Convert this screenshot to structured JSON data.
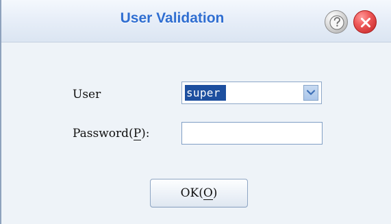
{
  "dialog": {
    "title": "User Validation",
    "colors": {
      "title_text": "#2f6ed1",
      "help_button": "#b5b5b5",
      "close_button": "#d73b3b"
    },
    "icons": {
      "help": "question-icon",
      "close": "close-icon",
      "dropdown": "chevron-down-icon"
    }
  },
  "form": {
    "user_label": "User",
    "user_value": "super",
    "password_label_prefix": "Password(",
    "password_label_mnemonic": "P",
    "password_label_suffix": "):",
    "password_value": ""
  },
  "buttons": {
    "ok_prefix": "OK(",
    "ok_mnemonic": "O",
    "ok_suffix": ")"
  }
}
